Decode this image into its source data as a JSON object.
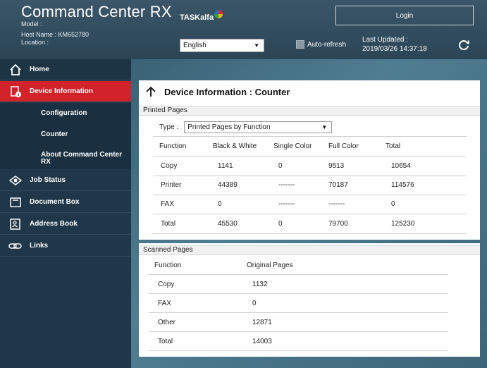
{
  "header": {
    "app_title": "Command Center RX",
    "model_label": "Model :",
    "host_label": "Host Name : KM652780",
    "location_label": "Location :",
    "brand": "TASKalfa",
    "login_label": "Login",
    "language": "English",
    "auto_refresh_label": "Auto-refresh",
    "last_updated_label": "Last Updated :",
    "last_updated_value": "2019/03/26 14:37:18"
  },
  "sidebar": {
    "items": [
      {
        "label": "Home",
        "icon": "home-icon"
      },
      {
        "label": "Device Information",
        "icon": "device-info-icon",
        "active": true
      },
      {
        "label": "Job Status",
        "icon": "eye-icon"
      },
      {
        "label": "Document Box",
        "icon": "document-box-icon"
      },
      {
        "label": "Address Book",
        "icon": "address-book-icon"
      },
      {
        "label": "Links",
        "icon": "link-icon"
      }
    ],
    "sub_items": [
      "Configuration",
      "Counter",
      "About Command Center RX"
    ]
  },
  "main": {
    "page_title": "Device Information : Counter",
    "printed": {
      "section_title": "Printed Pages",
      "type_label": "Type :",
      "type_value": "Printed Pages by Function",
      "columns": [
        "Function",
        "Black & White",
        "Single Color",
        "Full Color",
        "Total"
      ],
      "rows": [
        [
          "Copy",
          "1141",
          "0",
          "9513",
          "10654"
        ],
        [
          "Printer",
          "44389",
          "-------",
          "70187",
          "114576"
        ],
        [
          "FAX",
          "0",
          "-------",
          "-------",
          "0"
        ],
        [
          "Total",
          "45530",
          "0",
          "79700",
          "125230"
        ]
      ]
    },
    "scanned": {
      "section_title": "Scanned Pages",
      "columns": [
        "Function",
        "Original Pages"
      ],
      "rows": [
        [
          "Copy",
          "1132"
        ],
        [
          "FAX",
          "0"
        ],
        [
          "Other",
          "12871"
        ],
        [
          "Total",
          "14003"
        ]
      ]
    }
  },
  "colors": {
    "header_bg": "#2b4555",
    "sidebar_bg": "#1f3748",
    "active_item": "#d2222a",
    "panel_bg": "#ffffff"
  }
}
